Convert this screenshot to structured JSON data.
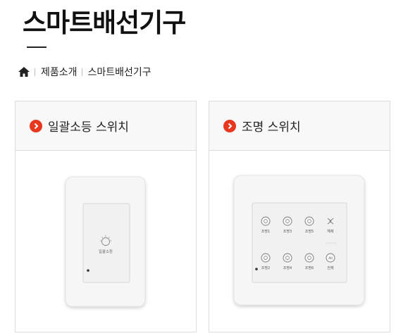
{
  "header": {
    "title": "스마트배선기구"
  },
  "breadcrumb": {
    "home_icon": "home-icon",
    "items": [
      "제품소개",
      "스마트배선기구"
    ]
  },
  "products": [
    {
      "name": "일괄소등 스위치",
      "switch_label": "일괄소등"
    },
    {
      "name": "조명 스위치",
      "buttons": [
        "조명1",
        "조명3",
        "조명5",
        "해제",
        "조명2",
        "조명4",
        "조명6",
        "전체"
      ],
      "all_icon_text": "All"
    }
  ],
  "colors": {
    "accent": "#e8371f",
    "header_bg": "#f8f8f8",
    "border": "#dcdcdc"
  }
}
